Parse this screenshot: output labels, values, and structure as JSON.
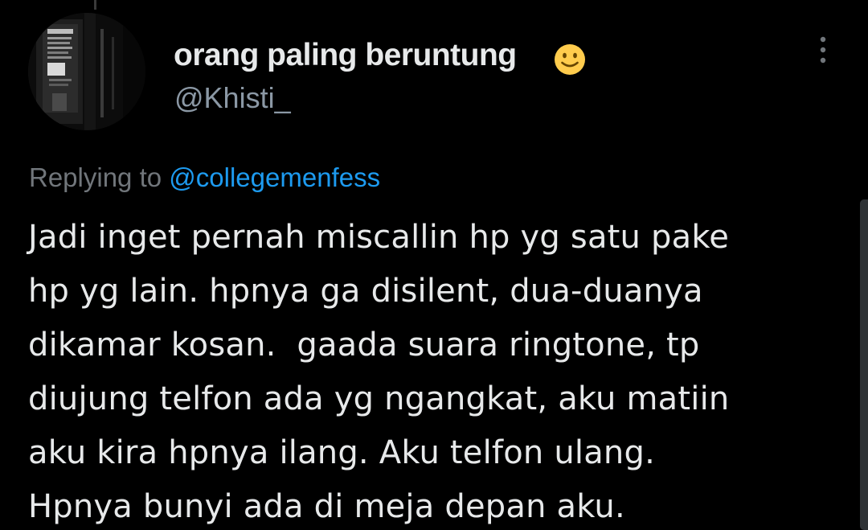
{
  "author": {
    "display_name": "orang paling beruntung",
    "emoji_icon": "slightly-smiling-face-icon",
    "handle": "@Khisti_"
  },
  "reply": {
    "prefix": "Replying to",
    "mention": "@collegemenfess"
  },
  "tweet": {
    "lines": [
      "Jadi inget pernah miscallin hp yg satu pake",
      "hp yg lain. hpnya ga disilent, dua-duanya",
      "dikamar kosan.  gaada suara ringtone, tp",
      "diujung telfon ada yg ngangkat, aku matiin",
      "aku kira hpnya ilang. Aku telfon ulang.",
      "Hpnya bunyi ada di meja depan aku."
    ]
  },
  "icons": {
    "more": "more-options-icon"
  },
  "colors": {
    "background": "#000000",
    "primary_text": "#e7e9ea",
    "secondary_text": "#71767b",
    "mention": "#1d9bf0"
  }
}
